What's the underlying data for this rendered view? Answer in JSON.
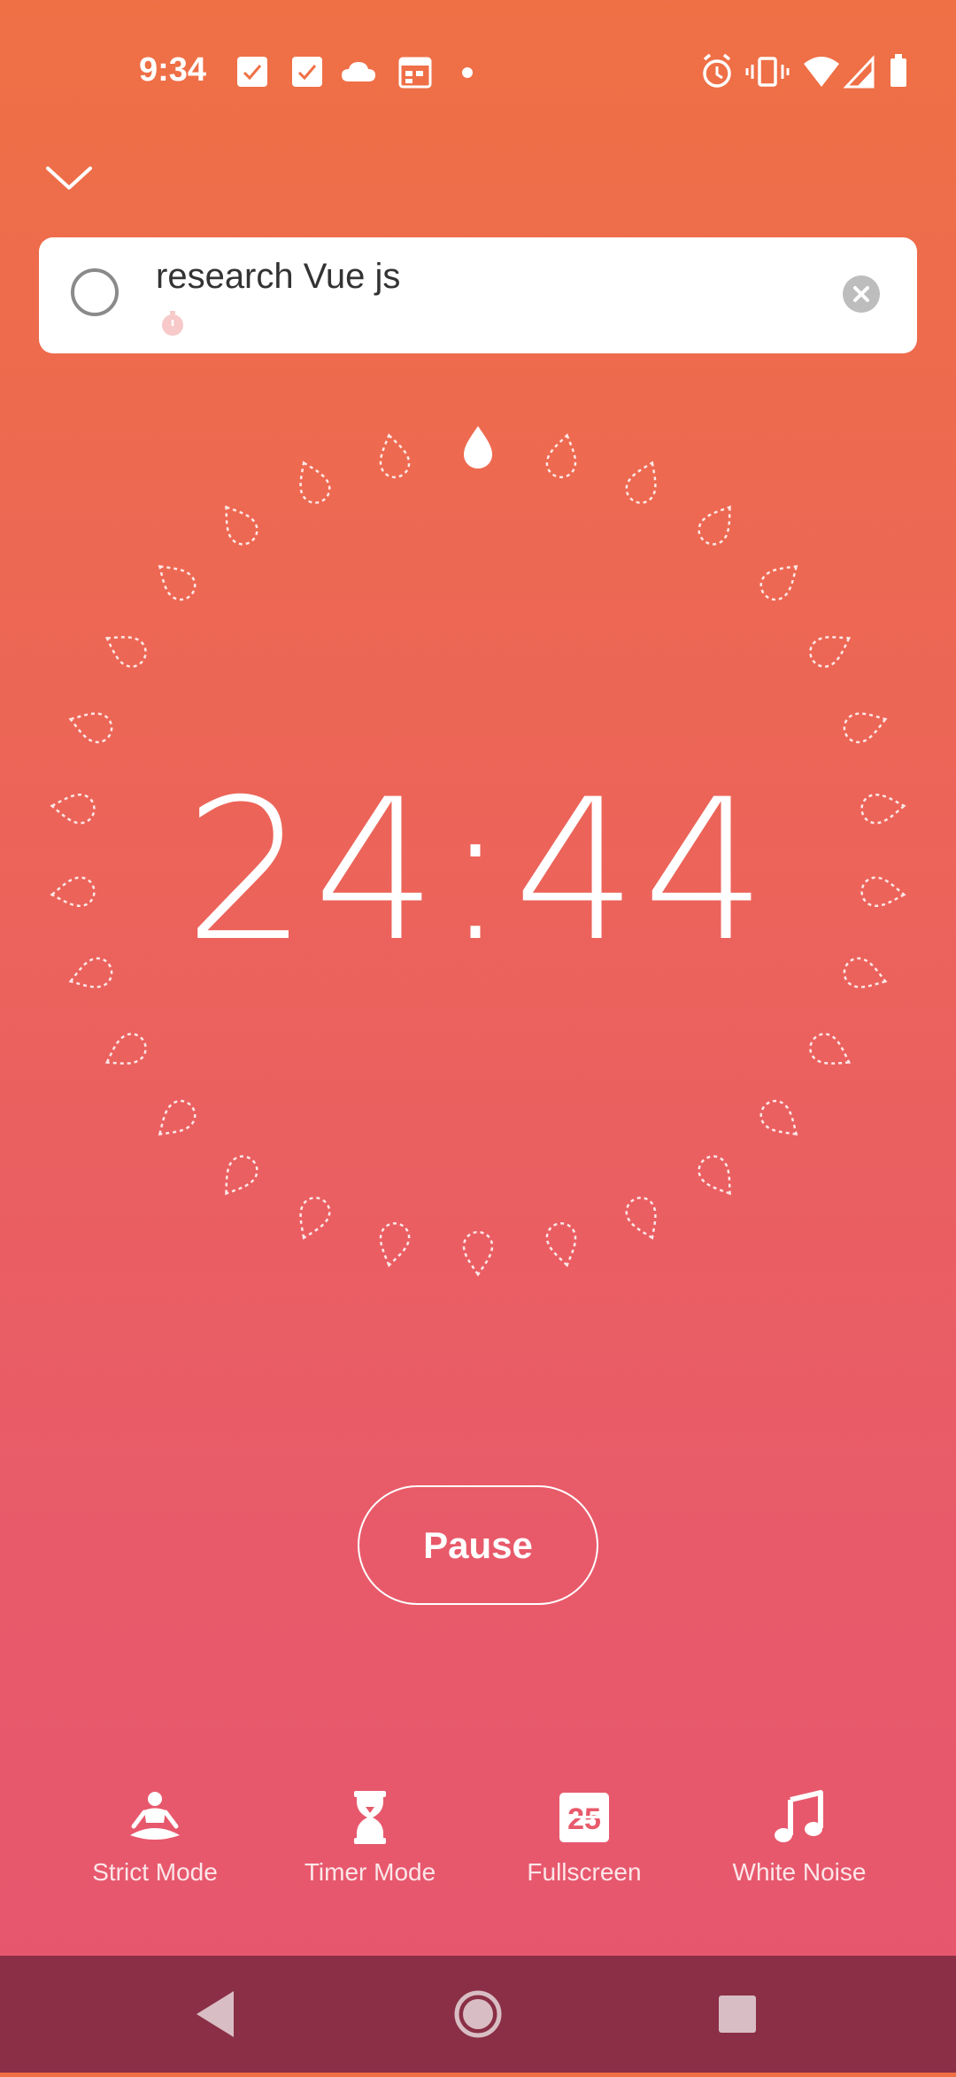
{
  "status_bar": {
    "time": "9:34",
    "left_icons": [
      "calendar-check-icon",
      "calendar-check-icon",
      "cloud-icon",
      "calendar-icon",
      "dot-icon"
    ],
    "right_icons": [
      "alarm-icon",
      "vibrate-icon",
      "wifi-icon",
      "signal-icon",
      "battery-icon"
    ]
  },
  "header": {
    "collapse_icon": "chevron-down-icon"
  },
  "task": {
    "title": "research Vue js",
    "pomo_icon": "pomodoro-icon",
    "clear_icon": "close-icon"
  },
  "timer": {
    "display": "24:44",
    "total_drops": 30,
    "completed_drops": 1
  },
  "controls": {
    "pause_label": "Pause"
  },
  "tools": [
    {
      "label": "Strict Mode",
      "icon": "meditation-icon"
    },
    {
      "label": "Timer Mode",
      "icon": "hourglass-icon"
    },
    {
      "label": "Fullscreen",
      "icon": "flip-clock-icon"
    },
    {
      "label": "White Noise",
      "icon": "music-note-icon"
    }
  ],
  "colors": {
    "gradient_top": "#EF7045",
    "gradient_bottom": "#E6566F",
    "nav_bar": "#8A2F45"
  }
}
